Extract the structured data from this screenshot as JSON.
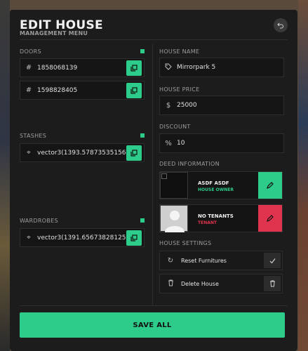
{
  "header": {
    "title": "EDIT HOUSE",
    "subtitle": "MANAGEMENT MENU"
  },
  "doors": {
    "label": "DOORS",
    "items": [
      {
        "value": "1858068139"
      },
      {
        "value": "1598828405"
      }
    ]
  },
  "stashes": {
    "label": "STASHES",
    "items": [
      {
        "value": "vector3(1393.57873535156"
      }
    ]
  },
  "wardrobes": {
    "label": "WARDROBES",
    "items": [
      {
        "value": "vector3(1391.65673828125."
      }
    ]
  },
  "house_name": {
    "label": "HOUSE NAME",
    "value": "Mirrorpark 5"
  },
  "house_price": {
    "label": "HOUSE PRICE",
    "currency": "$",
    "value": "25000"
  },
  "discount": {
    "label": "DISCOUNT",
    "symbol": "%",
    "value": "10"
  },
  "deed": {
    "label": "DEED INFORMATION",
    "owner": {
      "name": "ASDF ASDF",
      "role": "HOUSE OWNER",
      "role_color": "#2ecc8a"
    },
    "tenant": {
      "name": "NO TENANTS",
      "role": "TENANT",
      "role_color": "#e0344e"
    }
  },
  "settings": {
    "label": "HOUSE SETTINGS",
    "items": [
      {
        "label": "Reset Furnitures",
        "icon": "refresh-icon"
      },
      {
        "label": "Delete House",
        "icon": "trash-icon"
      }
    ]
  },
  "save_label": "SAVE ALL",
  "colors": {
    "accent": "#2ecc8a",
    "danger": "#e0344e",
    "panel": "#1c1c1c"
  }
}
